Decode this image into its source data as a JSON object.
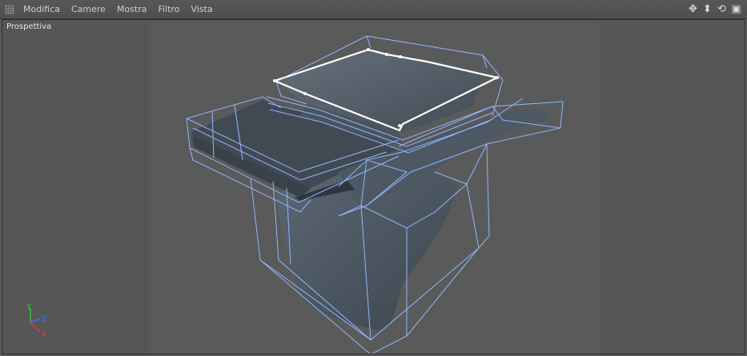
{
  "menu": {
    "items": [
      "Modifica",
      "Camere",
      "Mostra",
      "Filtro",
      "Vista"
    ]
  },
  "nav_icons": [
    "move-icon",
    "dolly-icon",
    "rotate-icon",
    "maximize-icon"
  ],
  "viewport": {
    "label": "Prospettiva"
  },
  "axes": {
    "y": "Y",
    "z": "Z",
    "x": "X"
  },
  "colors": {
    "background": "#565656",
    "cage": "#8fb7ff",
    "mesh": "#4f5b66",
    "selection": "#ffffff"
  }
}
